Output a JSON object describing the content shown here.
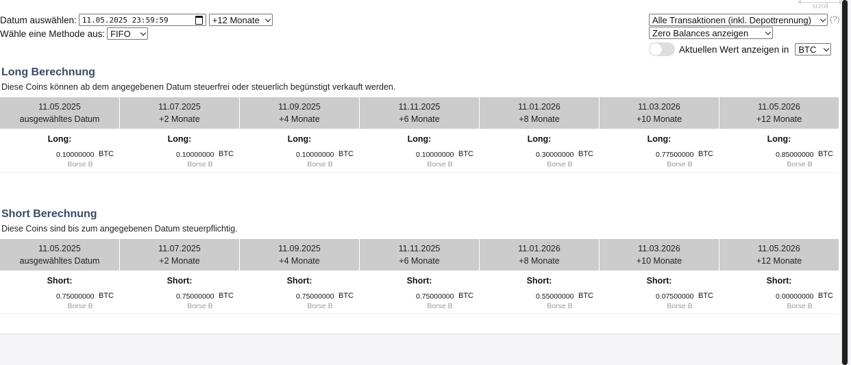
{
  "controls": {
    "date_label": "Datum auswählen:",
    "date_value": "11.05.2025 23:59:59",
    "period_select": "+12 Monate",
    "method_label": "Wähle eine Methode aus:",
    "method_select": "FIFO",
    "transactions_select": "Alle Transaktionen (inkl. Depottrennung)",
    "help_text": "(?)",
    "balances_select": "Zero Balances anzeigen",
    "toggle_label": "Aktuellen Wert anzeigen in",
    "toggle_on": false,
    "currency_select": "BTC",
    "scroll_hint": "scroll"
  },
  "long": {
    "title": "Long Berechnung",
    "description": "Diese Coins können ab dem angegebenen Datum steuerfrei oder steuerlich begünstigt verkauft werden.",
    "columns": [
      {
        "date": "11.05.2025",
        "sub": "ausgewähltes Datum",
        "kind": "Long:",
        "amount": "0.10000000",
        "currency": "BTC",
        "exchange": "Borse B"
      },
      {
        "date": "11.07.2025",
        "sub": "+2 Monate",
        "kind": "Long:",
        "amount": "0.10000000",
        "currency": "BTC",
        "exchange": "Borse B"
      },
      {
        "date": "11.09.2025",
        "sub": "+4 Monate",
        "kind": "Long:",
        "amount": "0.10000000",
        "currency": "BTC",
        "exchange": "Borse B"
      },
      {
        "date": "11.11.2025",
        "sub": "+6 Monate",
        "kind": "Long:",
        "amount": "0.10000000",
        "currency": "BTC",
        "exchange": "Borse B"
      },
      {
        "date": "11.01.2026",
        "sub": "+8 Monate",
        "kind": "Long:",
        "amount": "0.30000000",
        "currency": "BTC",
        "exchange": "Borse B"
      },
      {
        "date": "11.03.2026",
        "sub": "+10 Monate",
        "kind": "Long:",
        "amount": "0.77500000",
        "currency": "BTC",
        "exchange": "Borse B"
      },
      {
        "date": "11.05.2026",
        "sub": "+12 Monate",
        "kind": "Long:",
        "amount": "0.85000000",
        "currency": "BTC",
        "exchange": "Borse B"
      }
    ]
  },
  "short": {
    "title": "Short Berechnung",
    "description": "Diese Coins sind bis zum angegebenen Datum steuerpflichtig.",
    "columns": [
      {
        "date": "11.05.2025",
        "sub": "ausgewähltes Datum",
        "kind": "Short:",
        "amount": "0.75000000",
        "currency": "BTC",
        "exchange": "Borse B"
      },
      {
        "date": "11.07.2025",
        "sub": "+2 Monate",
        "kind": "Short:",
        "amount": "0.75000000",
        "currency": "BTC",
        "exchange": "Borse B"
      },
      {
        "date": "11.09.2025",
        "sub": "+4 Monate",
        "kind": "Short:",
        "amount": "0.75000000",
        "currency": "BTC",
        "exchange": "Borse B"
      },
      {
        "date": "11.11.2025",
        "sub": "+6 Monate",
        "kind": "Short:",
        "amount": "0.75000000",
        "currency": "BTC",
        "exchange": "Borse B"
      },
      {
        "date": "11.01.2026",
        "sub": "+8 Monate",
        "kind": "Short:",
        "amount": "0.55000000",
        "currency": "BTC",
        "exchange": "Borse B"
      },
      {
        "date": "11.03.2026",
        "sub": "+10 Monate",
        "kind": "Short:",
        "amount": "0.07500000",
        "currency": "BTC",
        "exchange": "Borse B"
      },
      {
        "date": "11.05.2026",
        "sub": "+12 Monate",
        "kind": "Short:",
        "amount": "0.00000000",
        "currency": "BTC",
        "exchange": "Borse B"
      }
    ]
  }
}
